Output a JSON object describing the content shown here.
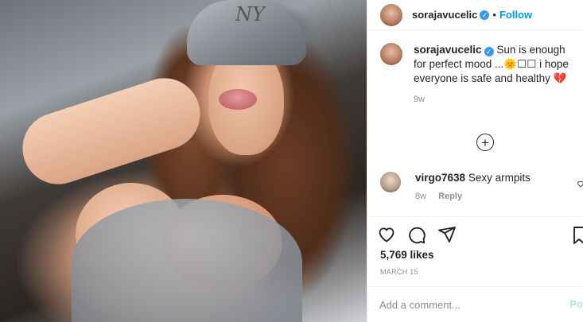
{
  "header": {
    "username": "sorajavucelic",
    "verified_mark": "✓",
    "separator": "•",
    "follow_label": "Follow"
  },
  "caption": {
    "username": "sorajavucelic",
    "verified_mark": "✓",
    "text": "Sun is enough for perfect mood ...🌞☐☐ i hope everyone is safe and healthy 💔",
    "time": "9w"
  },
  "load_more": {
    "glyph": "+"
  },
  "comment": {
    "username": "virgo7638",
    "text": "Sexy armpits",
    "time": "8w",
    "reply_label": "Reply"
  },
  "actions": {
    "icons": [
      "heart-icon",
      "comment-icon",
      "share-icon",
      "bookmark-icon"
    ]
  },
  "likes": "5,769 likes",
  "date": "MARCH 15",
  "add_comment": {
    "placeholder": "Add a comment...",
    "post_label": "Po"
  },
  "colors": {
    "accent": "#0095f6",
    "verified": "#3897f0",
    "muted": "#8e8e8e",
    "text": "#262626",
    "post_disabled": "#b2dffc"
  }
}
